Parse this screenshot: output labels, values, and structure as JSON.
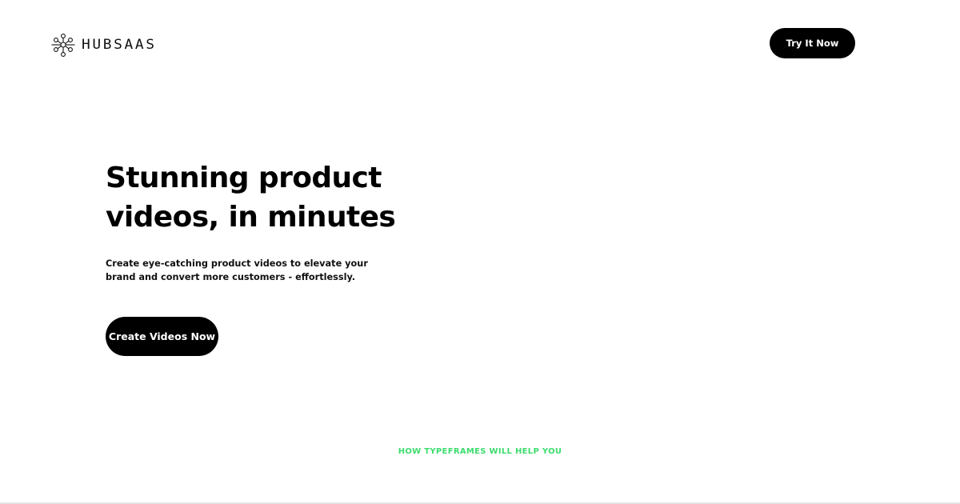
{
  "header": {
    "brand": "HUBSAAS",
    "logo_icon": "hub-network-icon",
    "cta_label": "Try It Now"
  },
  "hero": {
    "title_line1": "Stunning product",
    "title_line2": "videos, in minutes",
    "subtitle_line1": "Create eye-catching product videos to elevate your",
    "subtitle_line2": "brand and convert more customers - effortlessly.",
    "cta_label": "Create Videos Now"
  },
  "section": {
    "label": "HOW TYPEFRAMES WILL HELP YOU",
    "label_color": "#3ddc6e"
  },
  "colors": {
    "background": "#ffffff",
    "button": "#000000",
    "button_text": "#ffffff",
    "accent": "#3ddc6e"
  }
}
